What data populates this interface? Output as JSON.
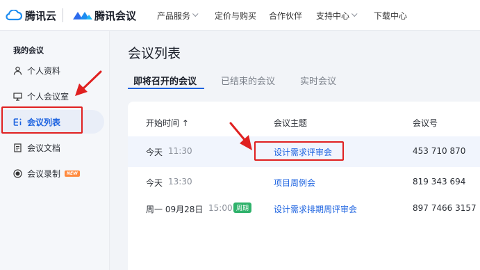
{
  "topnav": {
    "brand_cloud": "腾讯云",
    "brand_meeting": "腾讯会议",
    "items": [
      {
        "label": "产品服务",
        "has_dropdown": true
      },
      {
        "label": "定价与购买",
        "has_dropdown": false
      },
      {
        "label": "合作伙伴",
        "has_dropdown": false
      },
      {
        "label": "支持中心",
        "has_dropdown": true
      },
      {
        "label": "下载中心",
        "has_dropdown": false
      }
    ]
  },
  "sidebar": {
    "heading": "我的会议",
    "items": [
      {
        "label": "个人资料",
        "icon": "person-icon"
      },
      {
        "label": "个人会议室",
        "icon": "room-icon"
      },
      {
        "label": "会议列表",
        "icon": "list-icon",
        "active": true
      },
      {
        "label": "会议文档",
        "icon": "document-icon"
      },
      {
        "label": "会议录制",
        "icon": "record-icon",
        "badge": "NEW"
      }
    ]
  },
  "main": {
    "title": "会议列表",
    "tabs": [
      {
        "label": "即将召开的会议",
        "active": true
      },
      {
        "label": "已结束的会议",
        "active": false
      },
      {
        "label": "实时会议",
        "active": false
      }
    ],
    "table": {
      "columns": [
        "开始时间 ↑",
        "会议主题",
        "会议号"
      ],
      "rows": [
        {
          "day": "今天",
          "time": "11:30",
          "subject": "设计需求评审会",
          "id": "453 710 870",
          "highlighted": true
        },
        {
          "day": "今天",
          "time": "13:30",
          "subject": "项目周例会",
          "id": "819 343 694"
        },
        {
          "day": "周一 09月28日",
          "time": "15:00",
          "badge": "周期",
          "subject": "设计需求排期周评审会",
          "id": "897 7466 3157"
        }
      ]
    }
  },
  "colors": {
    "accent": "#1d63e0",
    "annotation": "#e02020",
    "cycle_badge": "#2fb26b",
    "new_badge": "#ff8a3d"
  }
}
